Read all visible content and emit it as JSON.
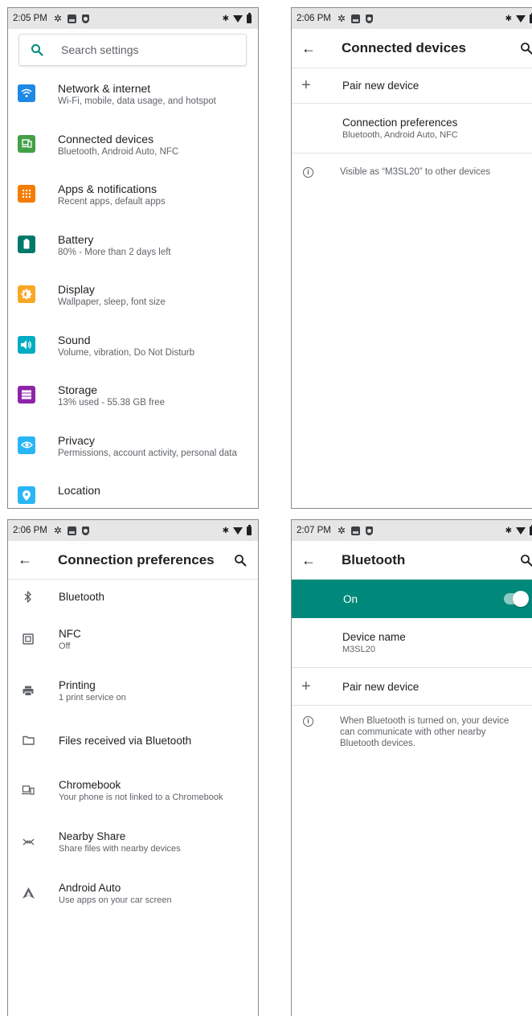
{
  "colors": {
    "accent": "#00897b",
    "bt_on_bar": "#00897b",
    "icon_network": "#1e88e5",
    "icon_connected": "#43a047",
    "icon_apps": "#f57c00",
    "icon_battery": "#00796b",
    "icon_display": "#f9a825",
    "icon_sound": "#00acc1",
    "icon_storage": "#8e24aa",
    "icon_privacy": "#29b6f6",
    "icon_location": "#29b6f6"
  },
  "screens": [
    {
      "status": {
        "time": "2:05 PM"
      },
      "search": {
        "placeholder": "Search settings",
        "icon": "search-icon"
      },
      "items": [
        {
          "title": "Network & internet",
          "subtitle": "Wi-Fi, mobile, data usage, and hotspot",
          "icon": "wifi-icon"
        },
        {
          "title": "Connected devices",
          "subtitle": "Bluetooth, Android Auto, NFC",
          "icon": "devices-icon"
        },
        {
          "title": "Apps & notifications",
          "subtitle": "Recent apps, default apps",
          "icon": "apps-icon"
        },
        {
          "title": "Battery",
          "subtitle": "80% - More than 2 days left",
          "icon": "battery-icon"
        },
        {
          "title": "Display",
          "subtitle": "Wallpaper, sleep, font size",
          "icon": "brightness-icon"
        },
        {
          "title": "Sound",
          "subtitle": "Volume, vibration, Do Not Disturb",
          "icon": "volume-icon"
        },
        {
          "title": "Storage",
          "subtitle": "13% used - 55.38 GB free",
          "icon": "storage-icon"
        },
        {
          "title": "Privacy",
          "subtitle": "Permissions, account activity, personal data",
          "icon": "privacy-icon"
        },
        {
          "title": "Location",
          "subtitle": "",
          "icon": "location-icon"
        }
      ]
    },
    {
      "status": {
        "time": "2:06 PM"
      },
      "title": "Connected devices",
      "pair_label": "Pair new device",
      "conn_prefs": {
        "title": "Connection preferences",
        "subtitle": "Bluetooth, Android Auto, NFC"
      },
      "info": "Visible as “M3SL20” to other devices"
    },
    {
      "status": {
        "time": "2:06 PM"
      },
      "title": "Connection preferences",
      "items": [
        {
          "title": "Bluetooth",
          "subtitle": "",
          "icon": "bluetooth-icon"
        },
        {
          "title": "NFC",
          "subtitle": "Off",
          "icon": "nfc-icon"
        },
        {
          "title": "Printing",
          "subtitle": "1 print service on",
          "icon": "printer-icon"
        },
        {
          "title": "Files received via Bluetooth",
          "subtitle": "",
          "icon": "folder-icon"
        },
        {
          "title": "Chromebook",
          "subtitle": "Your phone is not linked to a Chromebook",
          "icon": "chromebook-icon"
        },
        {
          "title": "Nearby Share",
          "subtitle": "Share files with nearby devices",
          "icon": "nearby-share-icon"
        },
        {
          "title": "Android Auto",
          "subtitle": "Use apps on your car screen",
          "icon": "android-auto-icon"
        }
      ]
    },
    {
      "status": {
        "time": "2:07 PM"
      },
      "title": "Bluetooth",
      "toggle_label": "On",
      "toggle_on": true,
      "device_name": {
        "title": "Device name",
        "value": "M3SL20"
      },
      "pair_label": "Pair new device",
      "info": "When Bluetooth is turned on, your device can communicate with other nearby Bluetooth devices."
    }
  ]
}
